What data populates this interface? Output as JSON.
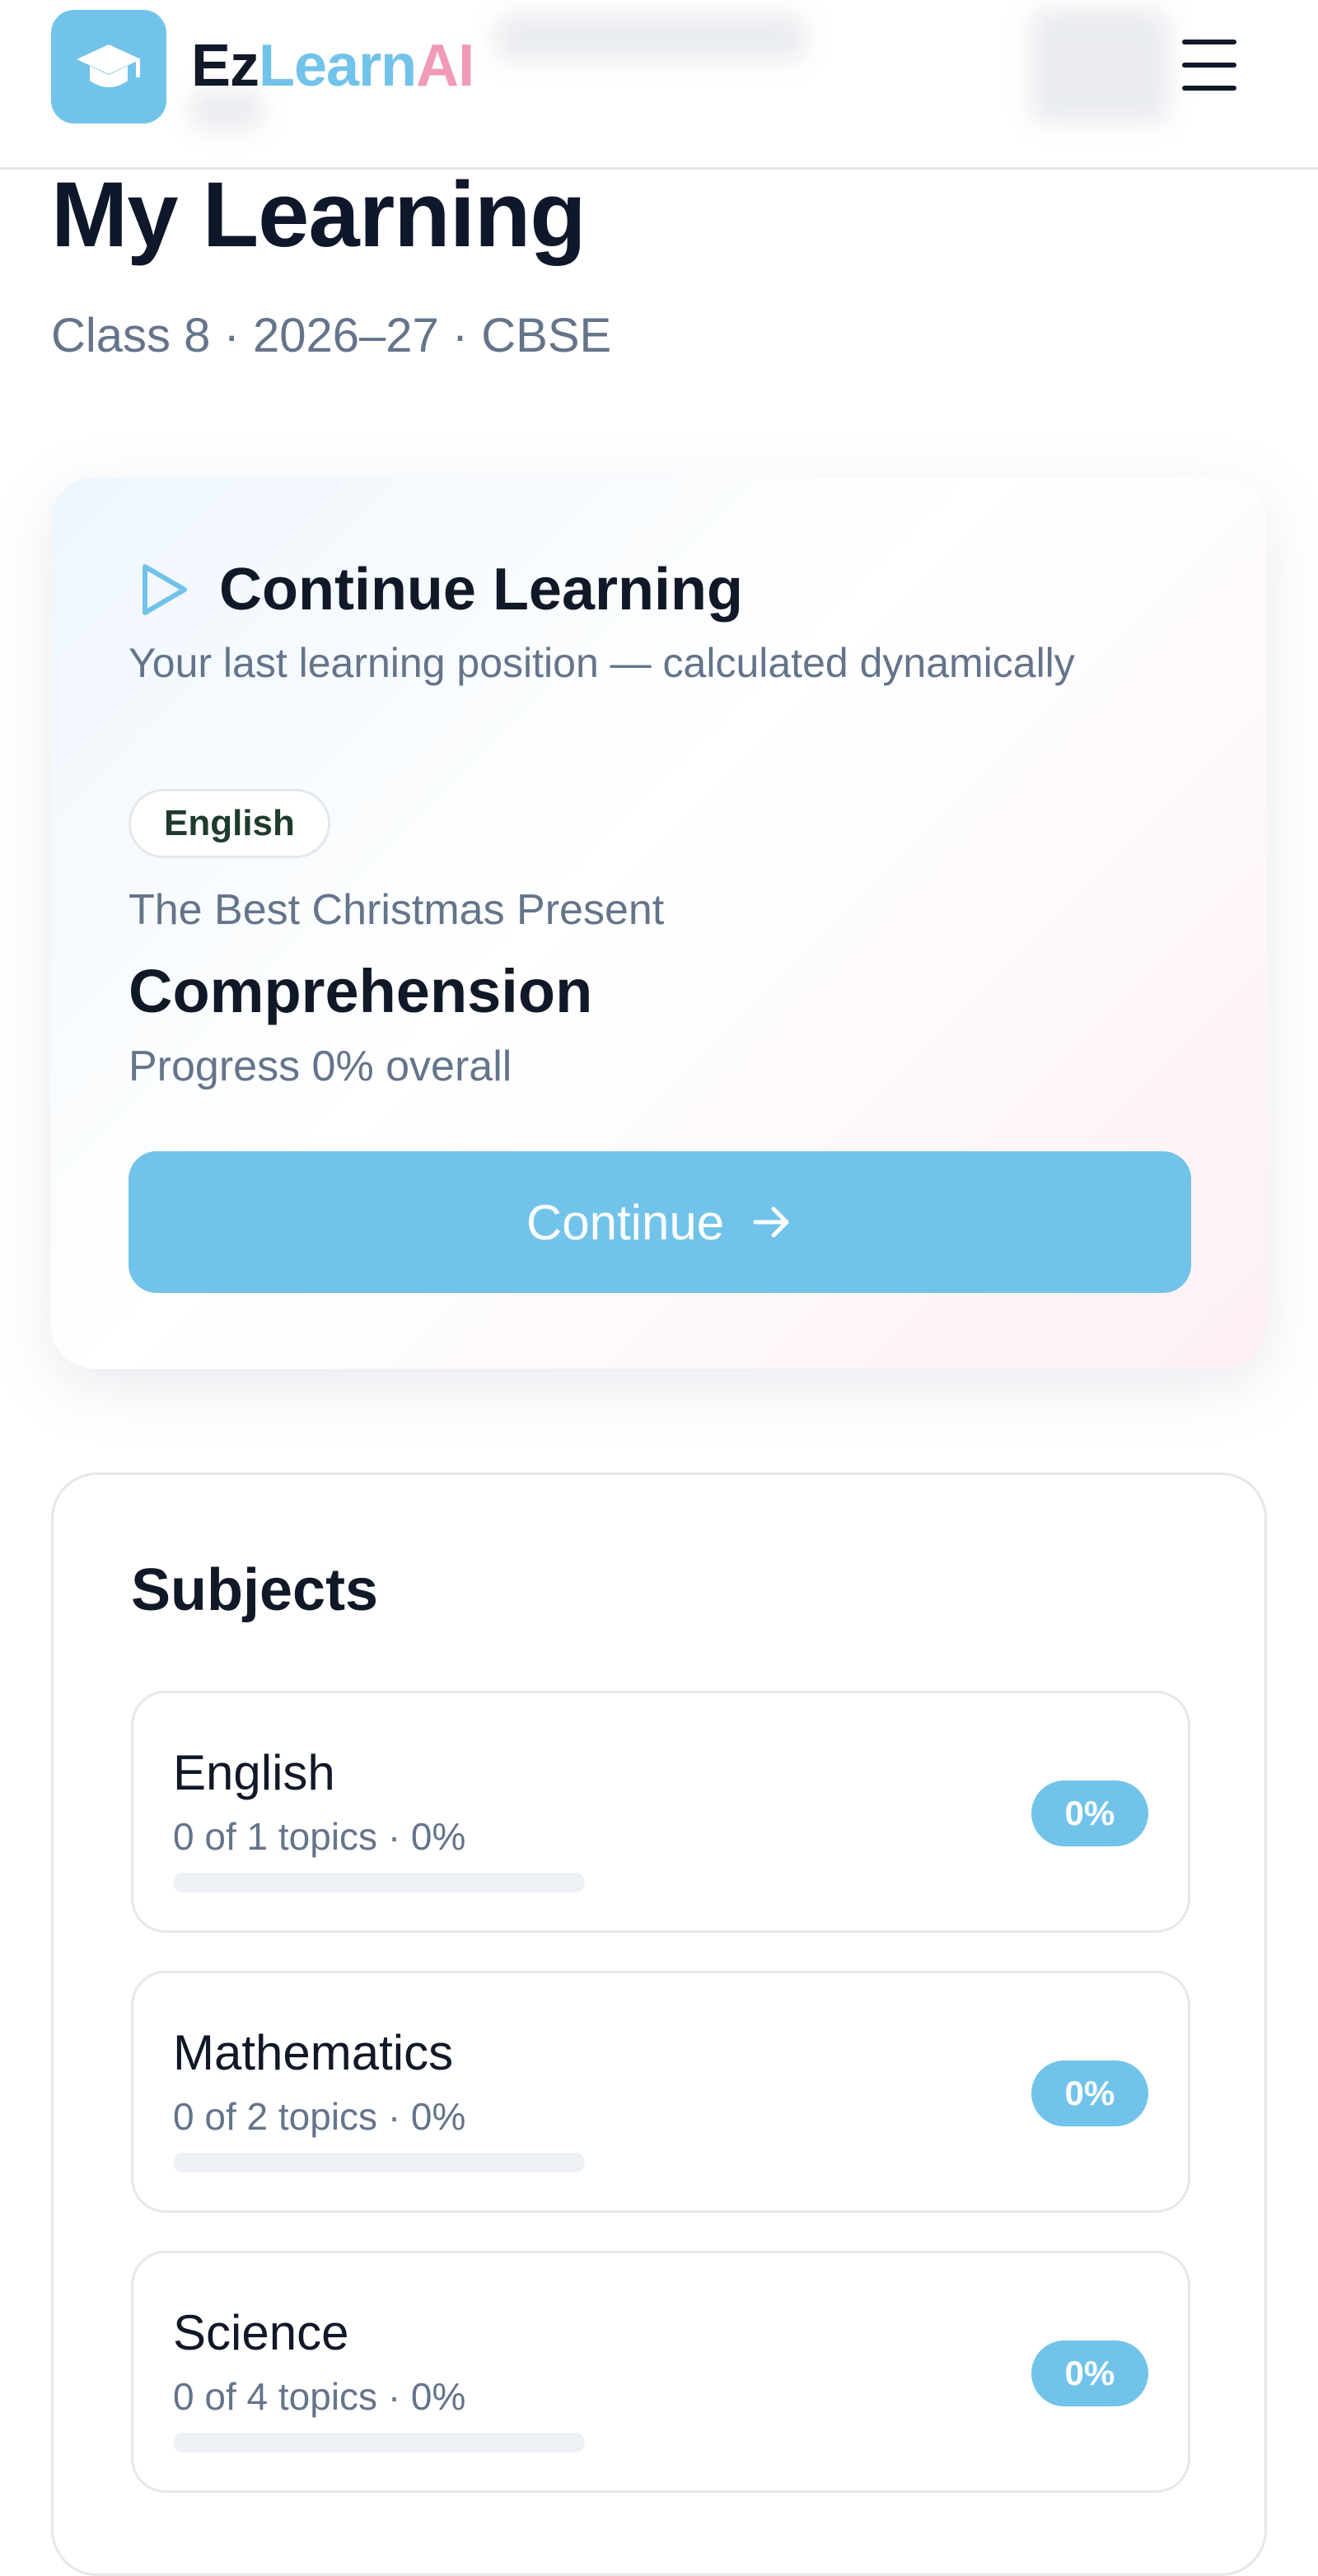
{
  "header": {
    "brand_ez": "Ez",
    "brand_learn": "Learn",
    "brand_ai": "AI",
    "logo_icon": "graduation-cap-icon",
    "menu_icon": "hamburger-menu-icon"
  },
  "page": {
    "title": "My Learning",
    "subtitle": "Class 8 · 2026–27 · CBSE"
  },
  "continue_learning": {
    "icon": "play-icon",
    "title": "Continue Learning",
    "subtitle": "Your last learning position — calculated dynamically",
    "subject_tag": "English",
    "chapter": "The Best Christmas Present",
    "topic": "Comprehension",
    "progress_text": "Progress 0% overall",
    "button_label": "Continue",
    "button_icon": "arrow-right-icon"
  },
  "subjects": {
    "title": "Subjects",
    "items": [
      {
        "name": "English",
        "meta": "0 of 1 topics · 0%",
        "badge": "0%",
        "progress": 0
      },
      {
        "name": "Mathematics",
        "meta": "0 of 2 topics · 0%",
        "badge": "0%",
        "progress": 0
      },
      {
        "name": "Science",
        "meta": "0 of 4 topics · 0%",
        "badge": "0%",
        "progress": 0
      }
    ]
  },
  "colors": {
    "accent": "#72c3ea",
    "brand_pink": "#f09ab5",
    "text_dark": "#111827",
    "text_muted": "#64748b"
  }
}
